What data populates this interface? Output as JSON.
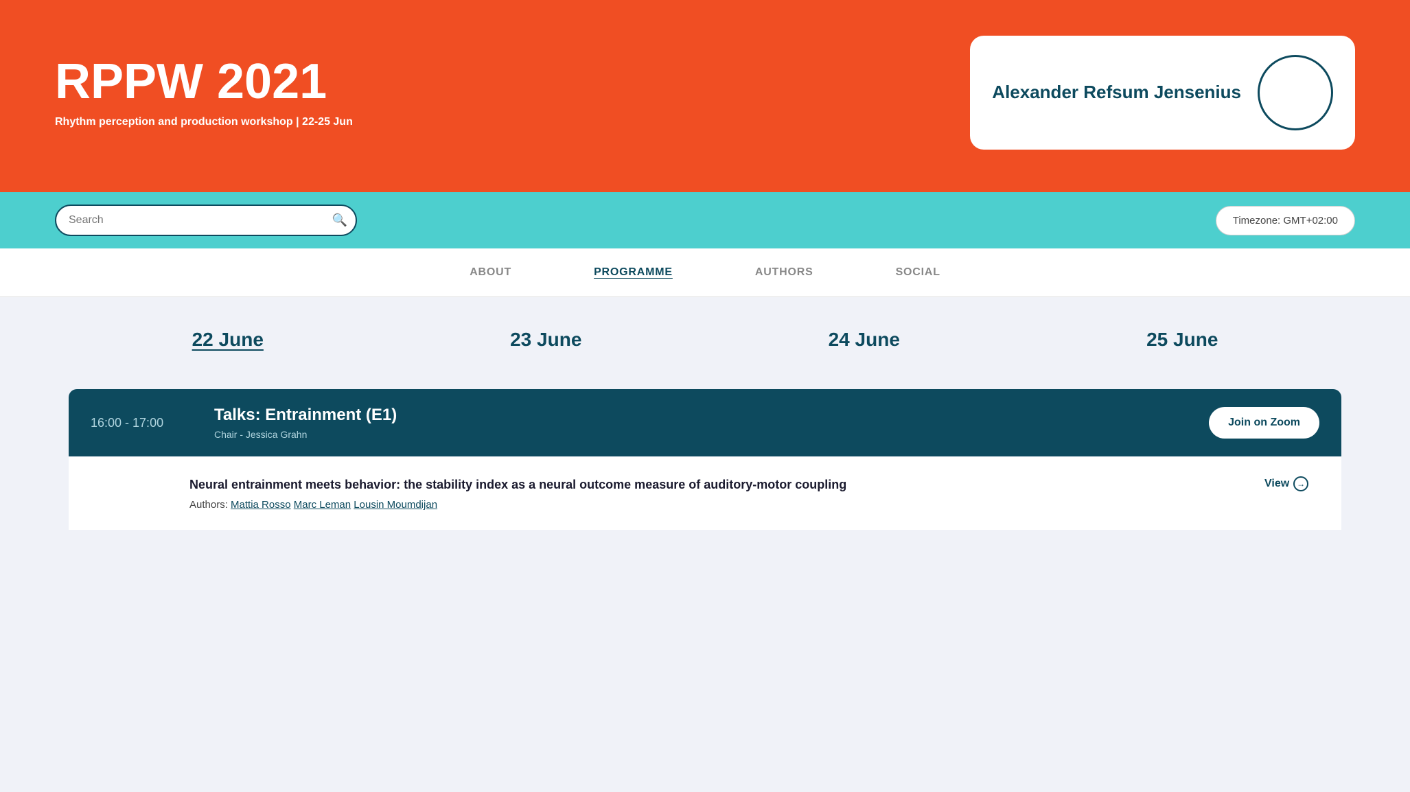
{
  "header": {
    "title": "RPPW 2021",
    "subtitle": "Rhythm perception and production workshop | 22-25 Jun",
    "bg_color": "#f04e23"
  },
  "profile": {
    "name": "Alexander Refsum Jensenius"
  },
  "search": {
    "placeholder": "Search",
    "timezone_label": "Timezone: GMT+02:00"
  },
  "nav": {
    "items": [
      {
        "label": "ABOUT",
        "active": false
      },
      {
        "label": "PROGRAMME",
        "active": true
      },
      {
        "label": "AUTHORS",
        "active": false
      },
      {
        "label": "SOCIAL",
        "active": false
      }
    ]
  },
  "programme_tabs": [
    {
      "label": "22 June",
      "active": true
    },
    {
      "label": "23 June",
      "active": false
    },
    {
      "label": "24 June",
      "active": false
    },
    {
      "label": "25 June",
      "active": false
    }
  ],
  "sessions": [
    {
      "time": "16:00 - 17:00",
      "title": "Talks: Entrainment (E1)",
      "chair": "Chair - Jessica Grahn",
      "join_label": "Join on Zoom",
      "papers": [
        {
          "title": "Neural entrainment meets behavior: the stability index as a neural outcome measure of auditory-motor coupling",
          "authors_prefix": "Authors: ",
          "authors": [
            {
              "name": "Mattia Rosso",
              "link": true
            },
            {
              "name": "Marc Leman",
              "link": true
            },
            {
              "name": "Lousin Moumdijan",
              "link": true
            }
          ],
          "view_label": "View"
        }
      ]
    }
  ]
}
